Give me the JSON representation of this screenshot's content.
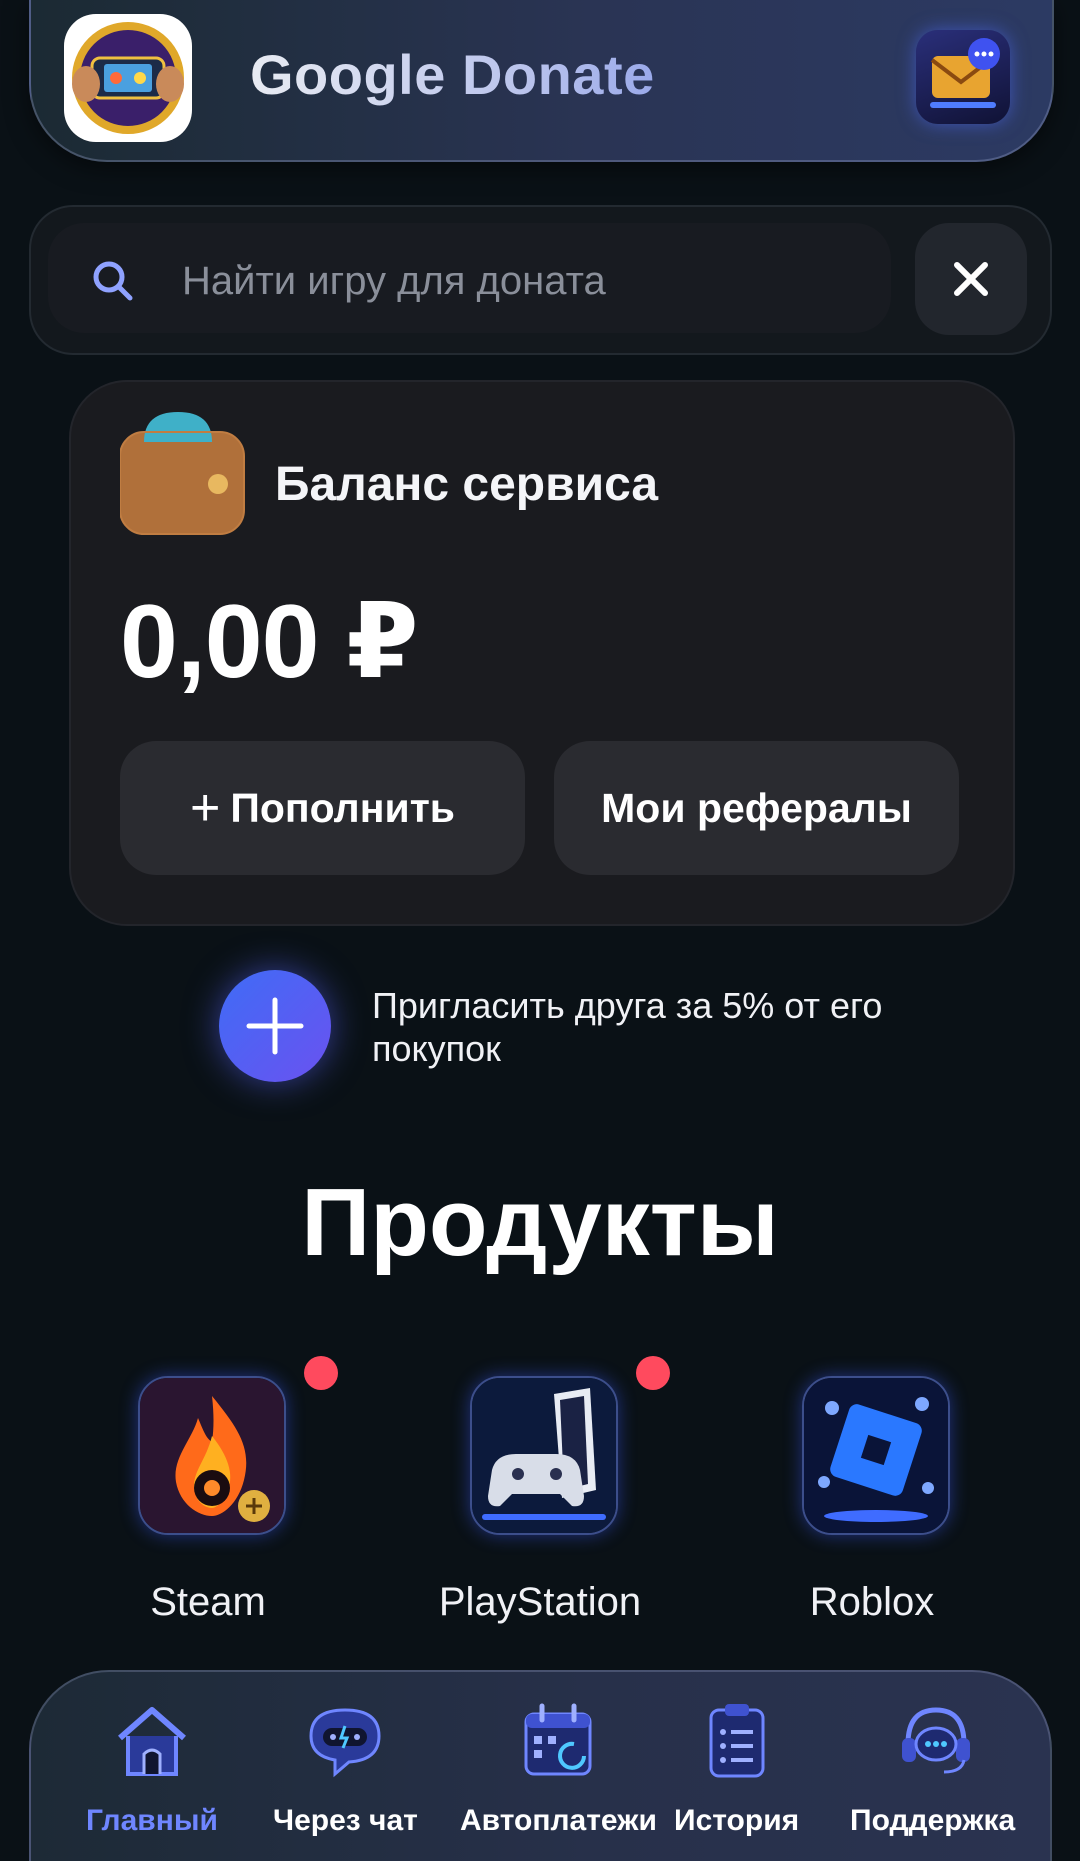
{
  "header": {
    "title": "Google Donate",
    "logo_icon": "gamepad-hands-icon",
    "mail_icon": "mail-icon"
  },
  "search": {
    "placeholder": "Найти игру для доната",
    "value": "",
    "search_icon": "search-icon",
    "clear_icon": "close-icon"
  },
  "balance": {
    "title": "Баланс сервиса",
    "amount": "0,00 ₽",
    "wallet_icon": "wallet-icon",
    "topup_label": "Пополнить",
    "topup_icon": "plus-icon",
    "referrals_label": "Мои рефералы"
  },
  "invite": {
    "text": "Пригласить друга за 5% от его покупок",
    "icon": "plus-icon"
  },
  "products": {
    "title": "Продукты",
    "items": [
      {
        "label": "Steam",
        "icon": "flame-icon",
        "has_badge": true
      },
      {
        "label": "PlayStation",
        "icon": "gamepad-icon",
        "has_badge": true
      },
      {
        "label": "Roblox",
        "icon": "roblox-cube-icon",
        "has_badge": false
      }
    ]
  },
  "nav": {
    "items": [
      {
        "label": "Главный",
        "icon": "home-icon",
        "active": true
      },
      {
        "label": "Через чат",
        "icon": "chat-gamepad-icon",
        "active": false
      },
      {
        "label": "Автоплатежи",
        "icon": "calendar-icon",
        "active": false
      },
      {
        "label": "История",
        "icon": "clipboard-list-icon",
        "active": false
      },
      {
        "label": "Поддержка",
        "icon": "headset-icon",
        "active": false
      }
    ]
  },
  "colors": {
    "background": "#0a1116",
    "accent": "#6f86ff",
    "card": "#1a1b1f",
    "badge": "#ff4a5e"
  }
}
